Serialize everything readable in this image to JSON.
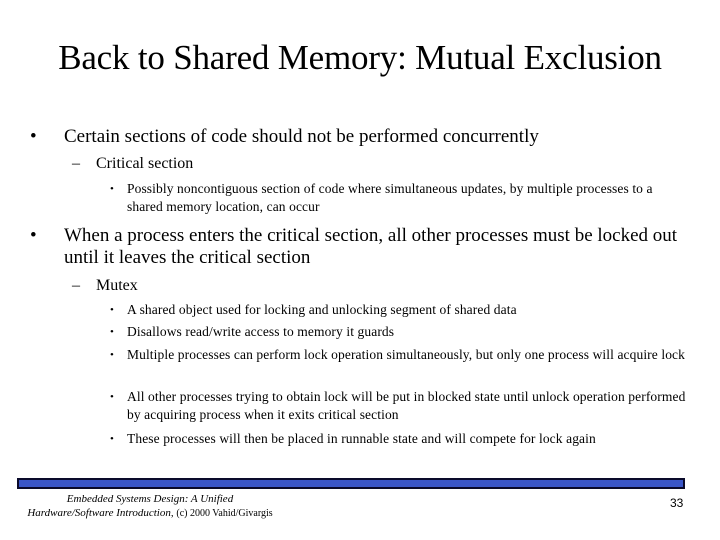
{
  "slide": {
    "title": "Back to Shared Memory: Mutual Exclusion",
    "bullet_glyph": "•",
    "dash_glyph": "–",
    "sub_bullet_glyph": "•",
    "points": [
      {
        "text": "Certain sections of code should not be performed concurrently",
        "sub": [
          {
            "text": "Critical section",
            "items": [
              "Possibly noncontiguous section of code where simultaneous updates, by multiple processes to a shared memory location, can occur"
            ]
          }
        ]
      },
      {
        "text": "When a process enters the critical section, all other processes must be locked out until it leaves the critical section",
        "sub": [
          {
            "text": "Mutex",
            "items": [
              "A shared object used for locking and unlocking segment of shared data",
              "Disallows read/write access to memory it guards",
              "Multiple processes can perform lock operation simultaneously, but only one process will acquire lock",
              "All other processes trying to obtain lock will be put in blocked state until unlock operation performed by acquiring process when it exits critical section",
              "These processes will then be placed in runnable state and will compete for lock again"
            ]
          }
        ]
      }
    ]
  },
  "footer": {
    "credit_line1": "Embedded Systems Design: A Unified",
    "credit_line2_italic": "Hardware/Software Introduction,",
    "credit_line2_plain": "(c) 2000 Vahid/Givargis",
    "page_number": "33",
    "bar_color": "#3a56c8"
  }
}
